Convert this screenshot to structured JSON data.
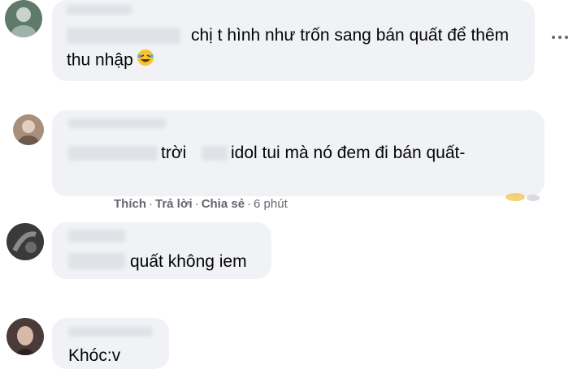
{
  "comments": [
    {
      "line1": "chị t hình như trốn sang bán quất để thêm",
      "line2": "thu nhập"
    },
    {
      "text_a": "trời",
      "text_b": "idol tui mà nó đem đi bán quất-"
    },
    {
      "text": "quất không iem"
    },
    {
      "text": "Khóc:v"
    }
  ],
  "actions": {
    "like": "Thích",
    "reply": "Trả lời",
    "share": "Chia sẻ",
    "separator": "·",
    "time": "6 phút"
  },
  "icons": {
    "more": "more-horizontal-icon",
    "laugh": "rofl-emoji-icon",
    "reactions": "reaction-icons"
  },
  "colors": {
    "bubble": "#f0f2f5",
    "text": "#050505",
    "secondary": "#65676b"
  }
}
